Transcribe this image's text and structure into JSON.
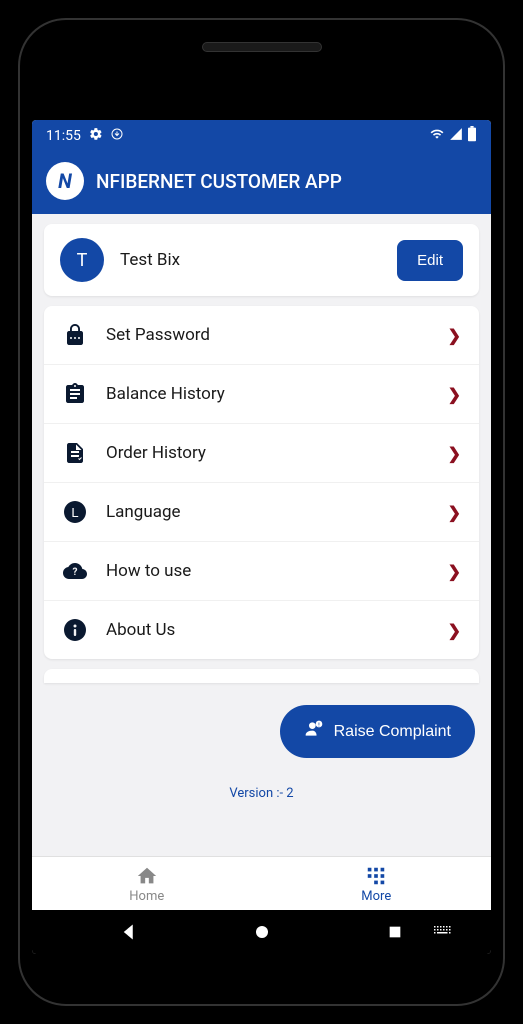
{
  "status": {
    "time": "11:55"
  },
  "header": {
    "title": "NFIBERNET CUSTOMER APP"
  },
  "profile": {
    "initial": "T",
    "name": "Test Bix",
    "editLabel": "Edit"
  },
  "menu": [
    {
      "id": "set-password",
      "label": "Set Password",
      "icon": "lock"
    },
    {
      "id": "balance-history",
      "label": "Balance History",
      "icon": "clipboard"
    },
    {
      "id": "order-history",
      "label": "Order History",
      "icon": "receipt"
    },
    {
      "id": "language",
      "label": "Language",
      "icon": "language"
    },
    {
      "id": "how-to-use",
      "label": "How to use",
      "icon": "help"
    },
    {
      "id": "about-us",
      "label": "About Us",
      "icon": "info"
    }
  ],
  "complaint": {
    "label": "Raise Complaint"
  },
  "version": "Version :- 2",
  "nav": {
    "home": "Home",
    "more": "More"
  }
}
